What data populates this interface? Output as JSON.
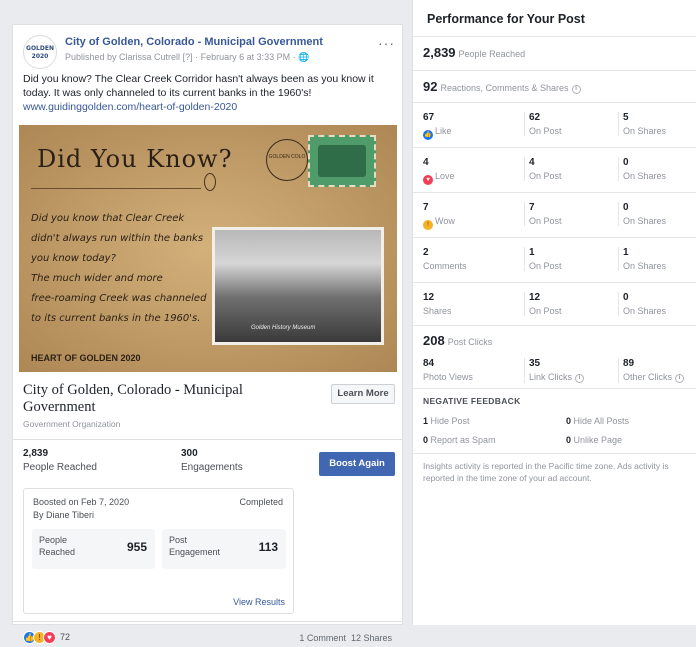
{
  "post": {
    "page_name": "City of Golden, Colorado - Municipal Government",
    "logo_text": "GOLDEN 2020",
    "published_by": "Published by Clarissa Cutrell",
    "published_hint": "[?]",
    "published_date": "February 6 at 3:33 PM",
    "menu_glyph": "···",
    "text": "Did you know? The Clear Creek Corridor hasn't always been as you know it today. It was only channeled to its current banks in the 1960's!",
    "link": "www.guidinggolden.com/heart-of-golden-2020",
    "image": {
      "title": "Did You Know?",
      "handwriting": [
        "Did you know that Clear Creek",
        "didn't always run within the banks",
        "you know today?",
        "The much wider and more",
        "free-roaming Creek was channeled",
        "to its current banks in the 1960's."
      ],
      "footer": "HEART OF GOLDEN 2020",
      "photo_caption": "Golden History Museum",
      "postmark": "GOLDEN COLO"
    },
    "cta": {
      "title": "City of Golden, Colorado - Municipal Government",
      "subtitle": "Government Organization",
      "button": "Learn More"
    },
    "stats": {
      "reached_value": "2,839",
      "reached_label": "People Reached",
      "engagements_value": "300",
      "engagements_label": "Engagements",
      "boost_button": "Boost Again"
    },
    "boost": {
      "date": "Boosted on Feb 7, 2020",
      "by": "By Diane Tiberi",
      "status": "Completed",
      "people_label": "People Reached",
      "people_value": "955",
      "engagement_label": "Post Engagement",
      "engagement_value": "113",
      "view_results": "View Results"
    },
    "footer": {
      "reaction_count": "72",
      "comments": "1 Comment",
      "shares": "12 Shares"
    }
  },
  "performance": {
    "title": "Performance for Your Post",
    "people_reached_value": "2,839",
    "people_reached_label": "People Reached",
    "reactions_value": "92",
    "reactions_label": "Reactions, Comments & Shares",
    "rows": [
      {
        "total": "67",
        "label": "Like",
        "on_post": "62",
        "on_post_label": "On Post",
        "on_shares": "5",
        "on_shares_label": "On Shares"
      },
      {
        "total": "4",
        "label": "Love",
        "on_post": "4",
        "on_post_label": "On Post",
        "on_shares": "0",
        "on_shares_label": "On Shares"
      },
      {
        "total": "7",
        "label": "Wow",
        "on_post": "7",
        "on_post_label": "On Post",
        "on_shares": "0",
        "on_shares_label": "On Shares"
      },
      {
        "total": "2",
        "label": "Comments",
        "on_post": "1",
        "on_post_label": "On Post",
        "on_shares": "1",
        "on_shares_label": "On Shares"
      },
      {
        "total": "12",
        "label": "Shares",
        "on_post": "12",
        "on_post_label": "On Post",
        "on_shares": "0",
        "on_shares_label": "On Shares"
      }
    ],
    "clicks_value": "208",
    "clicks_label": "Post Clicks",
    "clicks": [
      {
        "value": "84",
        "label": "Photo Views"
      },
      {
        "value": "35",
        "label": "Link Clicks"
      },
      {
        "value": "89",
        "label": "Other Clicks"
      }
    ],
    "negative_title": "NEGATIVE FEEDBACK",
    "negative": [
      {
        "value": "1",
        "label": "Hide Post"
      },
      {
        "value": "0",
        "label": "Hide All Posts"
      },
      {
        "value": "0",
        "label": "Report as Spam"
      },
      {
        "value": "0",
        "label": "Unlike Page"
      }
    ],
    "note": "Insights activity is reported in the Pacific time zone. Ads activity is reported in the time zone of your ad account."
  }
}
